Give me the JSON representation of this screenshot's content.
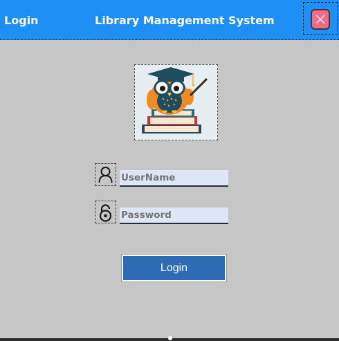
{
  "titlebar": {
    "left_label": "Login",
    "title": "Library Management System",
    "close_icon": "close-icon",
    "bg_color": "#1e90f5"
  },
  "logo": {
    "icon": "owl-books-logo-icon"
  },
  "form": {
    "username_icon": "user-icon",
    "username_placeholder": "UserName",
    "password_icon": "lock-icon",
    "password_placeholder": "Password",
    "login_label": "Login",
    "button_color": "#2e6bb5"
  }
}
